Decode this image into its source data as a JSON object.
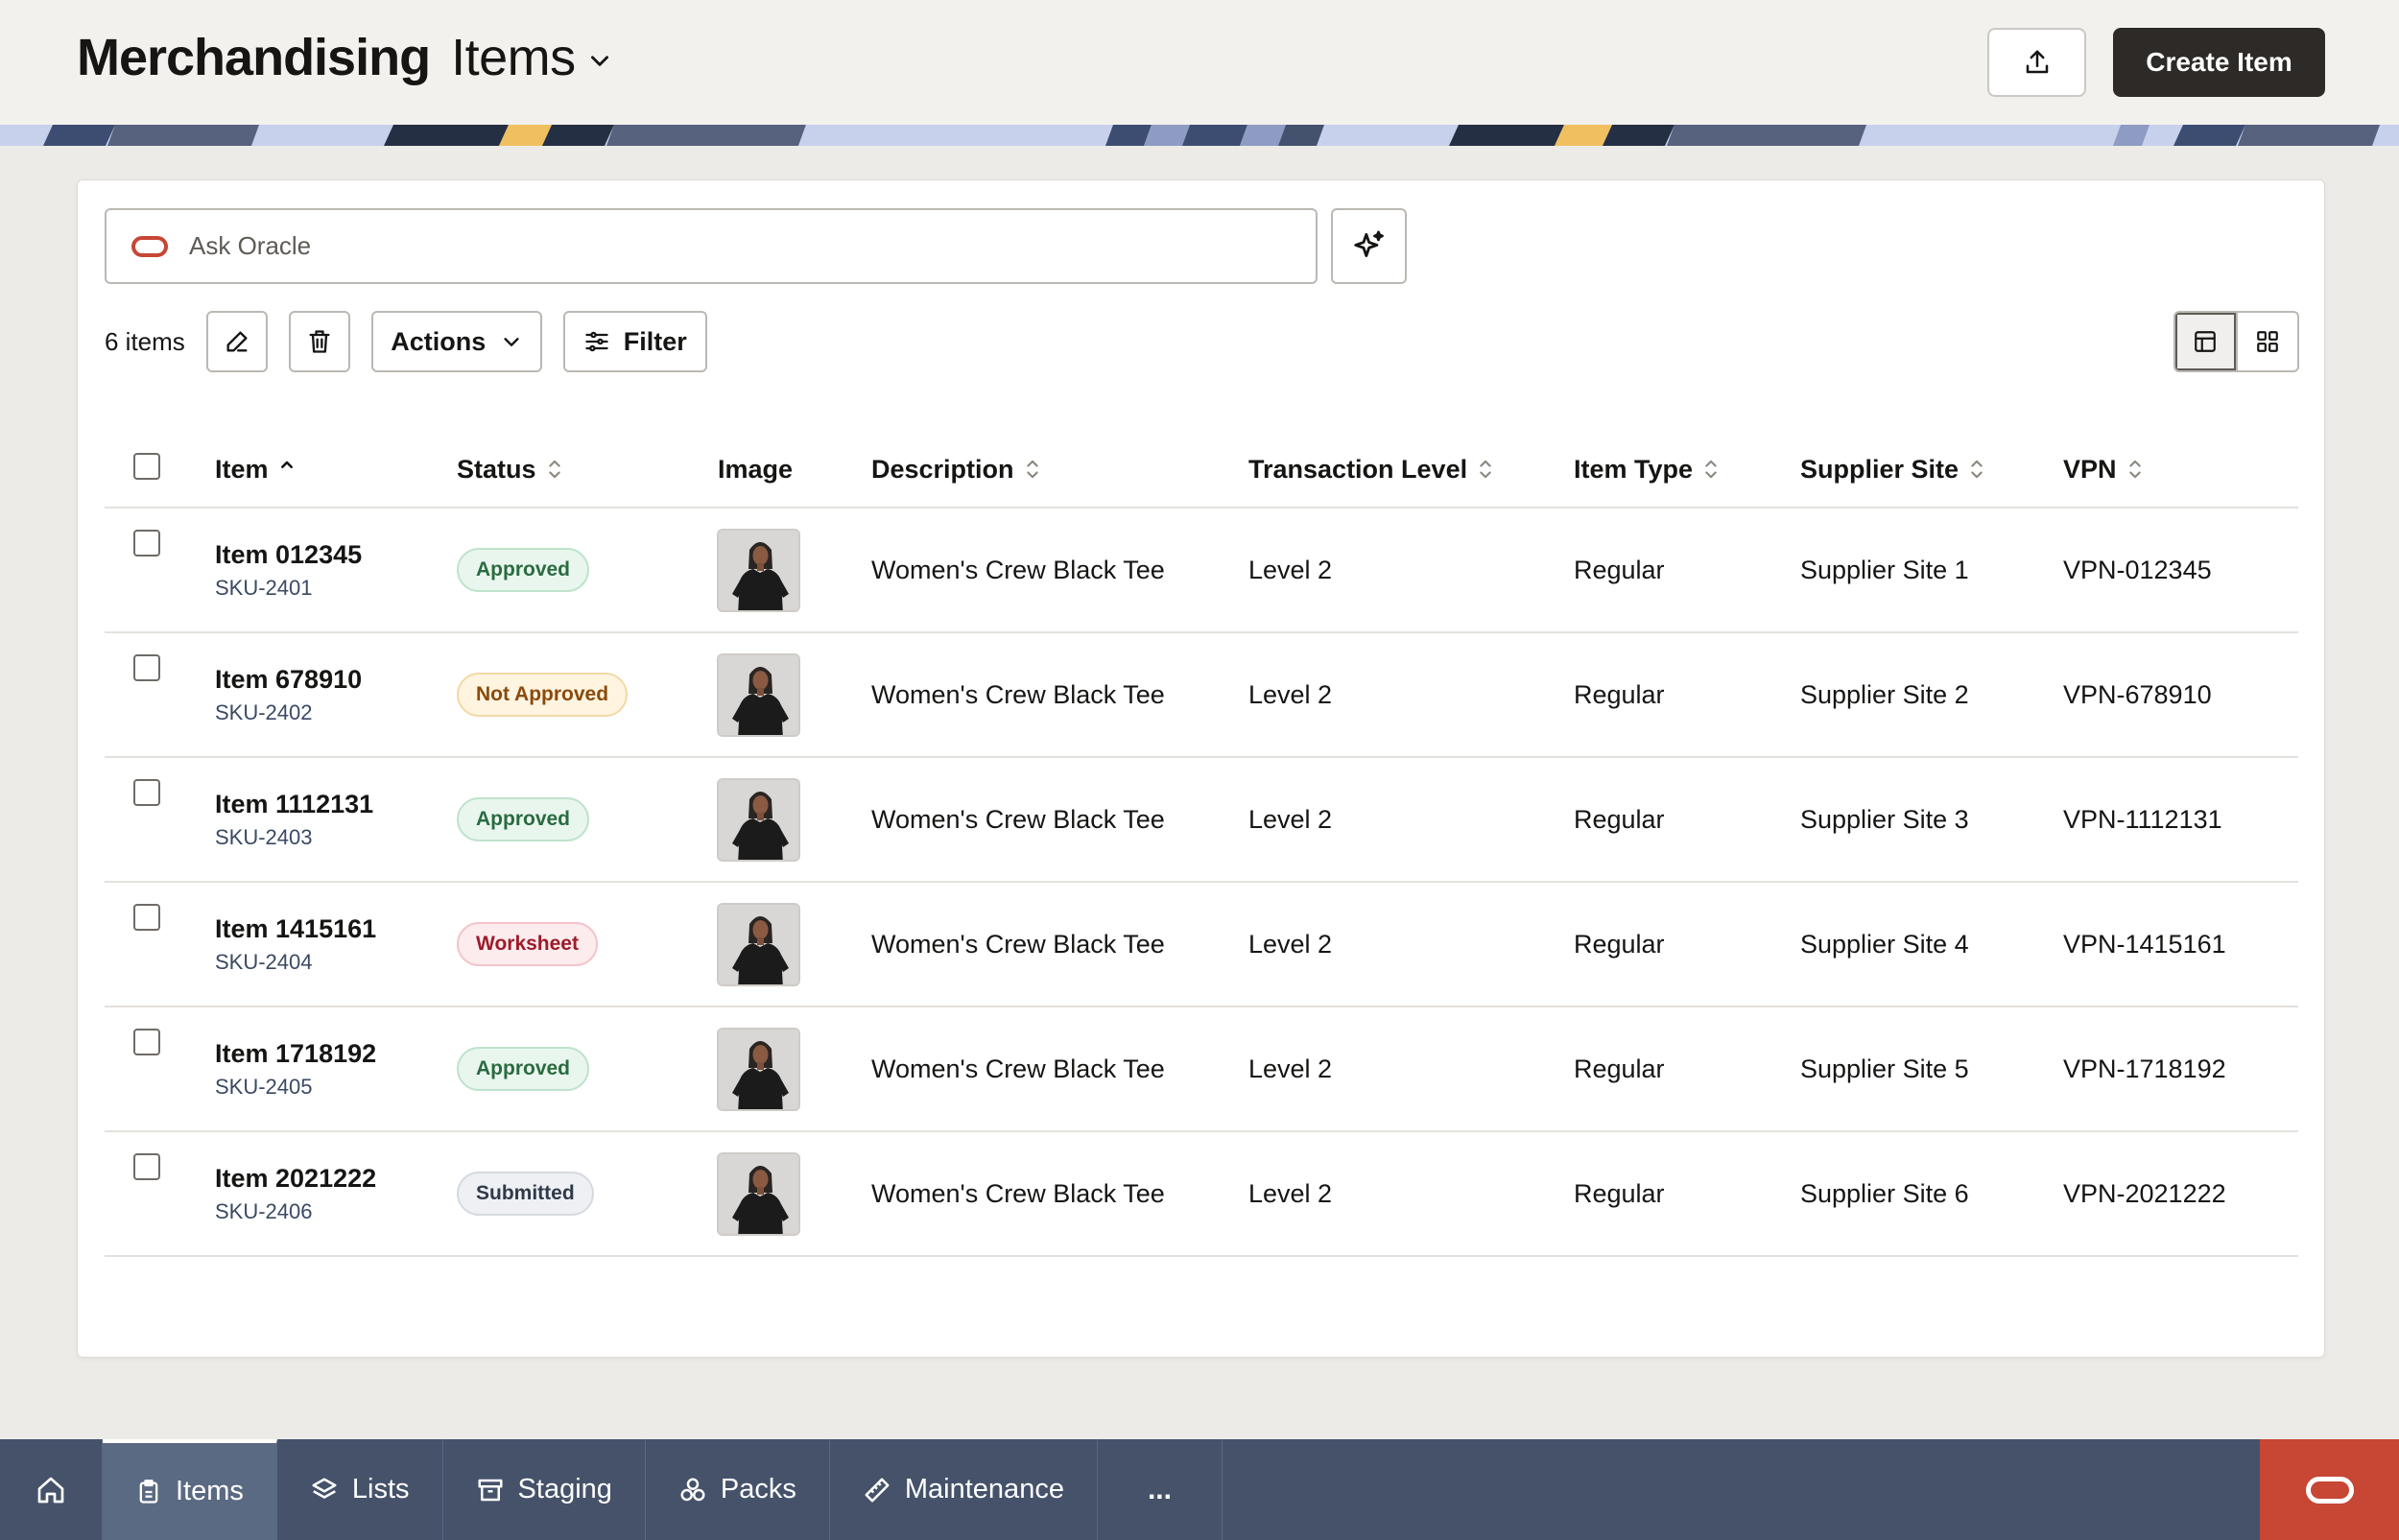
{
  "header": {
    "app_title": "Merchandising",
    "page_title": "Items",
    "create_label": "Create Item"
  },
  "search": {
    "placeholder": "Ask Oracle",
    "value": ""
  },
  "toolbar": {
    "count_label": "6 items",
    "actions_label": "Actions",
    "filter_label": "Filter"
  },
  "table": {
    "columns": [
      "Item",
      "Status",
      "Image",
      "Description",
      "Transaction Level",
      "Item Type",
      "Supplier Site",
      "VPN"
    ],
    "rows": [
      {
        "item": "Item 012345",
        "sku": "SKU-2401",
        "status": "Approved",
        "status_kind": "approved",
        "description": "Women's Crew Black Tee",
        "level": "Level 2",
        "type": "Regular",
        "site": "Supplier Site 1",
        "vpn": "VPN-012345"
      },
      {
        "item": "Item 678910",
        "sku": "SKU-2402",
        "status": "Not Approved",
        "status_kind": "notapproved",
        "description": "Women's Crew Black Tee",
        "level": "Level 2",
        "type": "Regular",
        "site": "Supplier Site 2",
        "vpn": "VPN-678910"
      },
      {
        "item": "Item 1112131",
        "sku": "SKU-2403",
        "status": "Approved",
        "status_kind": "approved",
        "description": "Women's Crew Black Tee",
        "level": "Level 2",
        "type": "Regular",
        "site": "Supplier Site 3",
        "vpn": "VPN-1112131"
      },
      {
        "item": "Item 1415161",
        "sku": "SKU-2404",
        "status": "Worksheet",
        "status_kind": "worksheet",
        "description": "Women's Crew Black Tee",
        "level": "Level 2",
        "type": "Regular",
        "site": "Supplier Site 4",
        "vpn": "VPN-1415161"
      },
      {
        "item": "Item 1718192",
        "sku": "SKU-2405",
        "status": "Approved",
        "status_kind": "approved",
        "description": "Women's Crew Black Tee",
        "level": "Level 2",
        "type": "Regular",
        "site": "Supplier Site 5",
        "vpn": "VPN-1718192"
      },
      {
        "item": "Item 2021222",
        "sku": "SKU-2406",
        "status": "Submitted",
        "status_kind": "submitted",
        "description": "Women's Crew Black Tee",
        "level": "Level 2",
        "type": "Regular",
        "site": "Supplier Site 6",
        "vpn": "VPN-2021222"
      }
    ]
  },
  "bottom_nav": {
    "items": [
      {
        "label": "Items",
        "icon": "clipboard-icon",
        "active": true
      },
      {
        "label": "Lists",
        "icon": "layers-icon",
        "active": false
      },
      {
        "label": "Staging",
        "icon": "archive-icon",
        "active": false
      },
      {
        "label": "Packs",
        "icon": "boxes-icon",
        "active": false
      },
      {
        "label": "Maintenance",
        "icon": "ruler-icon",
        "active": false
      }
    ],
    "more_label": "..."
  },
  "colors": {
    "accent_dark": "#2d2a27",
    "oracle_red": "#c74634",
    "nav_bg": "#45526a",
    "approved": "#2a6b40",
    "not_approved": "#8a4a0c",
    "worksheet": "#9e1a2a",
    "submitted": "#2f3a4a"
  }
}
